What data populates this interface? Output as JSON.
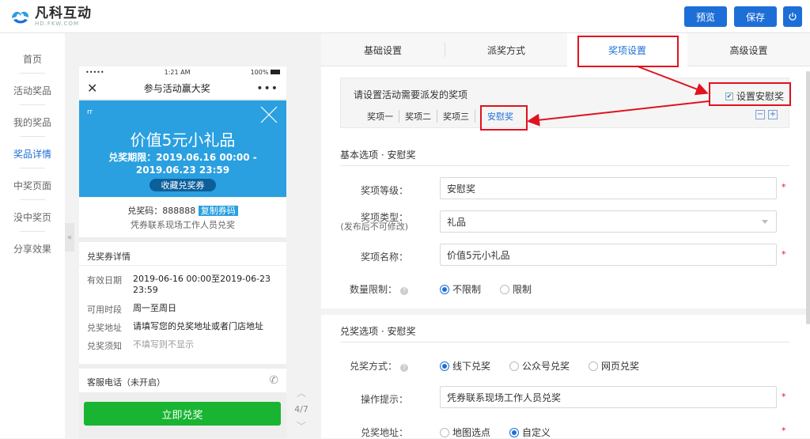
{
  "brand": {
    "name": "凡科互动",
    "sub": "HD.FKW.COM"
  },
  "topbar": {
    "preview": "预览",
    "save": "保存"
  },
  "nav": {
    "items": [
      "首页",
      "活动奖品",
      "我的奖品",
      "奖品详情",
      "中奖页面",
      "没中奖页",
      "分享效果"
    ],
    "active_index": 3
  },
  "phone": {
    "status_left": "•••••",
    "status_time": "1:21 AM",
    "status_right": "100%",
    "title": "参与活动赢大奖",
    "coupon": {
      "tag": "rr",
      "title": "价值5元小礼品",
      "date": "兑奖期限：2019.06.16 00:00 - 2019.06.23 23:59",
      "button": "收藏兑奖券"
    },
    "code": {
      "label": "兑奖码：",
      "value": "888888",
      "copy": "复制券码",
      "note": "凭券联系现场工作人员兑奖"
    },
    "detail": {
      "heading": "兑奖券详情",
      "rows": [
        {
          "label": "有效日期",
          "value": "2019-06-16 00:00至2019-06-23 23:59"
        },
        {
          "label": "可用时段",
          "value": "周一至周日"
        },
        {
          "label": "兑奖地址",
          "value": "请填写您的兑奖地址或者门店地址"
        },
        {
          "label": "兑奖须知",
          "value": "不填写则不显示"
        }
      ]
    },
    "service": "客服电话（未开启）",
    "redeem": "立即兑奖"
  },
  "pager": "4/7",
  "tabs": [
    "基础设置",
    "派奖方式",
    "奖项设置",
    "高级设置"
  ],
  "active_tab": 2,
  "award": {
    "hint": "请设置活动需要派发的奖项",
    "consolation_label": "设置安慰奖",
    "consolation_checked": true,
    "tabs": [
      "奖项一",
      "奖项二",
      "奖项三",
      "安慰奖"
    ],
    "active_tab": 3
  },
  "basic": {
    "title": "基本选项 · 安慰奖",
    "level_label": "奖项等级：",
    "level_value": "安慰奖",
    "type_label": "奖项类型：",
    "type_note": "(发布后不可修改)",
    "type_value": "礼品",
    "name_label": "奖项名称：",
    "name_value": "价值5元小礼品",
    "limit_label": "数量限制：",
    "limit_options": [
      "不限制",
      "限制"
    ],
    "limit_selected": 0
  },
  "redeem_opts": {
    "title": "兑奖选项 · 安慰奖",
    "method_label": "兑奖方式：",
    "method_options": [
      "线下兑奖",
      "公众号兑奖",
      "网页兑奖"
    ],
    "method_selected": 0,
    "tip_label": "操作提示：",
    "tip_value": "凭券联系现场工作人员兑奖",
    "addr_label": "兑奖地址：",
    "addr_options": [
      "地图选点",
      "自定义"
    ],
    "addr_selected": 1
  },
  "colors": {
    "primary": "#1d6fd7",
    "coupon": "#2aa0e0",
    "redeem": "#18b432",
    "highlight": "#e0121f"
  }
}
